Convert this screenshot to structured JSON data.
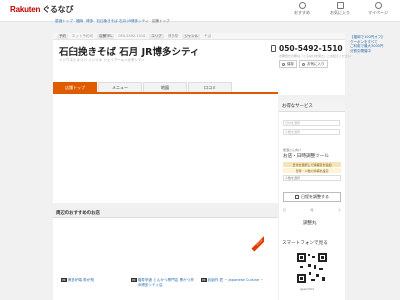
{
  "header": {
    "logo_rakuten": "Rakuten",
    "logo_gnavi": "ぐるなび",
    "icons": [
      {
        "label": "おすすめ",
        "icon": "bell-icon"
      },
      {
        "label": "お気に入り",
        "icon": "star-icon"
      },
      {
        "label": "マイページ",
        "icon": "user-icon"
      }
    ]
  },
  "breadcrumb": [
    "居酒トップ",
    "福岡",
    "博多",
    "石臼挽きそば 石月 JR博多シティ"
  ],
  "breadcrumb_current": "店舗トップ",
  "shop": {
    "info": [
      {
        "label": "予約",
        "value": "ネット予約可"
      },
      {
        "label": "店舗TEL",
        "value": "050-5492-1510"
      },
      {
        "label": "エリア",
        "value": "博多駅"
      },
      {
        "label": "ジャンル",
        "value": "そば"
      }
    ],
    "name": "石臼挽きそば 石月 JR博多シティ",
    "kana": "イシウスビキソバ イシヅキ ジェイアールハカタシティ",
    "phone": "050-5492-1510",
    "phone_note": "お問合せの際は「ぐるなびを見た」とお伝えください",
    "btn_save": "保存",
    "btn_favorite": "お気に入り"
  },
  "tabs": [
    {
      "label": "店舗トップ",
      "active": true
    },
    {
      "label": "メニュー",
      "active": false
    },
    {
      "label": "地図",
      "active": false
    },
    {
      "label": "口コミ",
      "active": false
    }
  ],
  "recommend": {
    "header": "周辺のおすすめのお店",
    "badge": "PR",
    "ribbon": "おすすめ",
    "items": [
      {
        "title": "博多炉端 魚が飛"
      },
      {
        "title": "福寿亭酒 とんかつ専門店 黒かつ亭 JR博多シティ店"
      },
      {
        "title": "凪創作 匠 ~ Japanese Cuisine ~"
      }
    ]
  },
  "side": {
    "header": "お得なサービス",
    "input1": "日付を選択",
    "input2": "人数を選択",
    "small": "居酒さん向け",
    "tool": "お店・日時調整ツール",
    "bar1": "日付を選択して候補日を追加",
    "bar2": "日時・人数の候補を設定",
    "select": "人数を選択",
    "button": "日程を調整する",
    "cols": [
      "日",
      "時",
      "人"
    ],
    "name": "調整丸",
    "phone_link": "スマートフォンで見る",
    "qr_code": "gsam004"
  },
  "ads": [
    "【福岡で100円オフ】",
    "クーポンをすべて",
    "ご利用で最大3000円",
    "分割引開催中"
  ]
}
